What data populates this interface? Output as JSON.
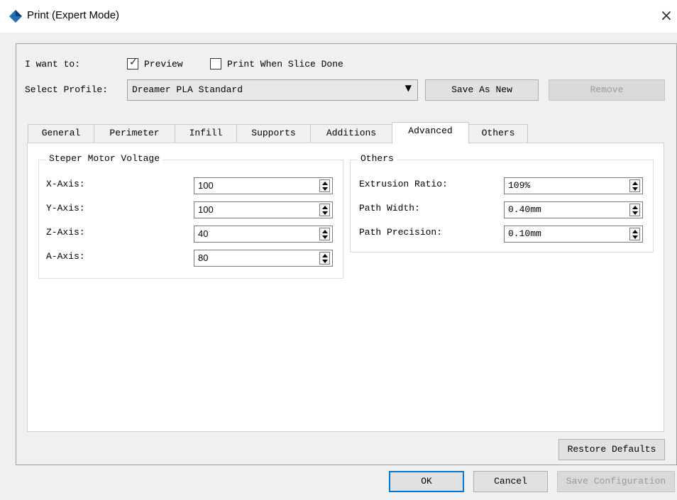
{
  "window": {
    "title": "Print (Expert Mode)",
    "close_icon": "×",
    "icon_color": "#1e6fb7"
  },
  "top": {
    "i_want_to_label": "I want to:",
    "preview_label": "Preview",
    "preview_checked": true,
    "print_when_done_label": "Print When Slice Done",
    "print_when_done_checked": false,
    "select_profile_label": "Select Profile:",
    "profile_value": "Dreamer PLA Standard",
    "save_as_new_label": "Save As New",
    "remove_label": "Remove"
  },
  "tabs": [
    {
      "label": "General"
    },
    {
      "label": "Perimeter"
    },
    {
      "label": "Infill"
    },
    {
      "label": "Supports"
    },
    {
      "label": "Additions"
    },
    {
      "label": "Advanced"
    },
    {
      "label": "Others"
    }
  ],
  "active_tab": "Advanced",
  "stepper_group": {
    "title": "Steper Motor Voltage",
    "fields": [
      {
        "label": "X-Axis:",
        "value": "100"
      },
      {
        "label": "Y-Axis:",
        "value": "100"
      },
      {
        "label": "Z-Axis:",
        "value": "40"
      },
      {
        "label": "A-Axis:",
        "value": "80"
      }
    ]
  },
  "others_group": {
    "title": "Others",
    "fields": [
      {
        "label": "Extrusion Ratio:",
        "value": "109%"
      },
      {
        "label": "Path Width:",
        "value": "0.40mm"
      },
      {
        "label": "Path Precision:",
        "value": "0.10mm"
      }
    ]
  },
  "restore_defaults_label": "Restore Defaults",
  "footer": {
    "ok_label": "OK",
    "cancel_label": "Cancel",
    "save_config_label": "Save Configuration"
  }
}
